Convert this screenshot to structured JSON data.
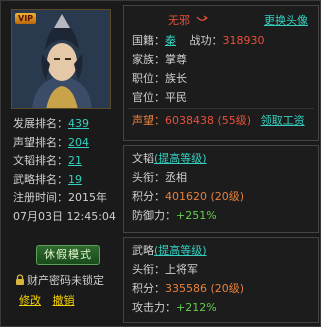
{
  "player": {
    "name": "无邪",
    "change_avatar": "更换头像",
    "vip": "VIP"
  },
  "stats": [
    {
      "label": "发展排名：",
      "value": "439"
    },
    {
      "label": "声望排名：",
      "value": "204"
    },
    {
      "label": "文韬排名：",
      "value": "21"
    },
    {
      "label": "武略排名：",
      "value": "19"
    },
    {
      "label": "注册时间：",
      "value": "2015年"
    },
    {
      "label": "",
      "value": "07月03日 12:45:04"
    }
  ],
  "vacation_button": "休假模式",
  "property_lock_text": "财产密码未锁定",
  "modify_link": "修改",
  "cancel_link": "撤销",
  "top_panel": {
    "nation_label": "国籍：",
    "nation_value": "秦",
    "power_label": "战功：",
    "power_value": "318930",
    "family_label": "家族：",
    "family_value": "掌尊",
    "position_label": "职位：",
    "position_value": "族长",
    "rank_label": "官位：",
    "rank_value": "平民",
    "prestige_label": "声望：",
    "prestige_value": "6038438 (55级)",
    "salary_link": "领取工资"
  },
  "wentao_panel": {
    "title": "文韬",
    "upgrade_link": "(提高等级)",
    "title_label": "头衔：",
    "title_value": "丞相",
    "points_label": "积分：",
    "points_value": "401620 (20级)",
    "defense_label": "防御力：",
    "defense_value": "+251%"
  },
  "wulue_panel": {
    "title": "武略",
    "upgrade_link": "(提高等级)",
    "title_label": "头衔：",
    "title_value": "上将军",
    "points_label": "积分：",
    "points_value": "335586 (20级)",
    "attack_label": "攻击力：",
    "attack_value": "+212%"
  },
  "colors": {
    "accent_cyan": "#33d0c0",
    "accent_red": "#e8503c",
    "accent_yellow": "#f5d300",
    "accent_green": "#63d04a"
  }
}
